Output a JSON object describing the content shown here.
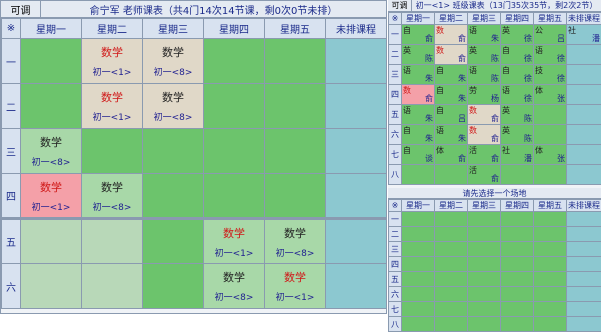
{
  "left_bar": {
    "btn": "可调",
    "title": "俞宁军 老师课表（共4门14次14节课，剩0次0节未排）"
  },
  "left_headers": [
    "※",
    "星期一",
    "星期二",
    "星期三",
    "星期四",
    "星期五",
    "未排课程"
  ],
  "left_rows": [
    {
      "label": "一",
      "cells": [
        {
          "bg": "g"
        },
        {
          "bg": "bg",
          "subj": "数学",
          "cls": "初一<1>",
          "sc": "cr"
        },
        {
          "bg": "bg",
          "subj": "数学",
          "cls": "初一<8>",
          "sc": "ck"
        },
        {
          "bg": "g"
        },
        {
          "bg": "g"
        },
        {
          "bg": "cy"
        }
      ]
    },
    {
      "label": "二",
      "cells": [
        {
          "bg": "g"
        },
        {
          "bg": "bg",
          "subj": "数学",
          "cls": "初一<1>",
          "sc": "cr"
        },
        {
          "bg": "bg",
          "subj": "数学",
          "cls": "初一<8>",
          "sc": "ck"
        },
        {
          "bg": "g"
        },
        {
          "bg": "g"
        },
        {
          "bg": "cy"
        }
      ]
    },
    {
      "label": "三",
      "cells": [
        {
          "bg": "pg",
          "subj": "数学",
          "cls": "初一<8>",
          "sc": "ck"
        },
        {
          "bg": "g"
        },
        {
          "bg": "g"
        },
        {
          "bg": "g"
        },
        {
          "bg": "g"
        },
        {
          "bg": "cy"
        }
      ]
    },
    {
      "label": "四",
      "cells": [
        {
          "bg": "pk",
          "subj": "数学",
          "cls": "初一<1>",
          "sc": "cr"
        },
        {
          "bg": "pg",
          "subj": "数学",
          "cls": "初一<8>",
          "sc": "ck"
        },
        {
          "bg": "g"
        },
        {
          "bg": "g"
        },
        {
          "bg": "g"
        },
        {
          "bg": "cy"
        }
      ]
    },
    {
      "label": "五",
      "cells": [
        {
          "bg": "lt"
        },
        {
          "bg": "lt"
        },
        {
          "bg": "g"
        },
        {
          "bg": "pg",
          "subj": "数学",
          "cls": "初一<1>",
          "sc": "cr"
        },
        {
          "bg": "pg",
          "subj": "数学",
          "cls": "初一<8>",
          "sc": "ck"
        },
        {
          "bg": "cy"
        }
      ]
    },
    {
      "label": "六",
      "cells": [
        {
          "bg": "lt"
        },
        {
          "bg": "lt"
        },
        {
          "bg": "g"
        },
        {
          "bg": "pg",
          "subj": "数学",
          "cls": "初一<8>",
          "sc": "ck"
        },
        {
          "bg": "pg",
          "subj": "数学",
          "cls": "初一<1>",
          "sc": "cr"
        },
        {
          "bg": "cy"
        }
      ]
    }
  ],
  "right_bar": {
    "btn": "可调",
    "title": "初一<1> 班级课表（13门35次35节，剩2次2节）"
  },
  "right_headers": [
    "※",
    "星期一",
    "星期二",
    "星期三",
    "星期四",
    "星期五",
    "未排课程"
  ],
  "right_rows": [
    {
      "label": "一",
      "cells": [
        {
          "s": "自",
          "t": "俞",
          "bg": "g"
        },
        {
          "s": "数",
          "t": "俞",
          "bg": "bg",
          "sc": "cr"
        },
        {
          "s": "语",
          "t": "朱",
          "bg": "g"
        },
        {
          "s": "英",
          "t": "徐",
          "bg": "g"
        },
        {
          "s": "公",
          "t": "吕",
          "bg": "g"
        },
        {
          "s": "社",
          "t": "潘",
          "bg": "cy"
        }
      ]
    },
    {
      "label": "二",
      "cells": [
        {
          "s": "英",
          "t": "陈",
          "bg": "g"
        },
        {
          "s": "数",
          "t": "俞",
          "bg": "bg",
          "sc": "cr"
        },
        {
          "s": "英",
          "t": "陈",
          "bg": "g"
        },
        {
          "s": "自",
          "t": "徐",
          "bg": "g"
        },
        {
          "s": "语",
          "t": "徐",
          "bg": "g"
        },
        {
          "s": "",
          "t": "",
          "bg": "cy"
        }
      ]
    },
    {
      "label": "三",
      "cells": [
        {
          "s": "语",
          "t": "朱",
          "bg": "g"
        },
        {
          "s": "自",
          "t": "朱",
          "bg": "g"
        },
        {
          "s": "语",
          "t": "陈",
          "bg": "g"
        },
        {
          "s": "自",
          "t": "徐",
          "bg": "g"
        },
        {
          "s": "技",
          "t": "徐",
          "bg": "g"
        },
        {
          "s": "",
          "t": "",
          "bg": "cy"
        }
      ]
    },
    {
      "label": "四",
      "cells": [
        {
          "s": "数",
          "t": "俞",
          "bg": "pk",
          "sc": "cr"
        },
        {
          "s": "自",
          "t": "朱",
          "bg": "g"
        },
        {
          "s": "劳",
          "t": "杨",
          "bg": "g"
        },
        {
          "s": "语",
          "t": "徐",
          "bg": "g"
        },
        {
          "s": "体",
          "t": "张",
          "bg": "g"
        },
        {
          "s": "",
          "t": "",
          "bg": "cy"
        }
      ]
    },
    {
      "label": "五",
      "cells": [
        {
          "s": "语",
          "t": "朱",
          "bg": "g"
        },
        {
          "s": "自",
          "t": "吕",
          "bg": "g"
        },
        {
          "s": "数",
          "t": "俞",
          "bg": "bg",
          "sc": "cr"
        },
        {
          "s": "英",
          "t": "陈",
          "bg": "g"
        },
        {
          "s": "",
          "t": "",
          "bg": "g"
        },
        {
          "s": "",
          "t": "",
          "bg": "cy"
        }
      ]
    },
    {
      "label": "六",
      "cells": [
        {
          "s": "自",
          "t": "朱",
          "bg": "g"
        },
        {
          "s": "语",
          "t": "朱",
          "bg": "g"
        },
        {
          "s": "数",
          "t": "俞",
          "bg": "bg",
          "sc": "cr"
        },
        {
          "s": "英",
          "t": "陈",
          "bg": "g"
        },
        {
          "s": "",
          "t": "",
          "bg": "g"
        },
        {
          "s": "",
          "t": "",
          "bg": "cy"
        }
      ]
    },
    {
      "label": "七",
      "cells": [
        {
          "s": "自",
          "t": "谈",
          "bg": "g"
        },
        {
          "s": "体",
          "t": "俞",
          "bg": "g"
        },
        {
          "s": "活",
          "t": "俞",
          "bg": "g"
        },
        {
          "s": "社",
          "t": "潘",
          "bg": "g"
        },
        {
          "s": "体",
          "t": "张",
          "bg": "g"
        },
        {
          "s": "",
          "t": "",
          "bg": "cy"
        }
      ]
    },
    {
      "label": "八",
      "cells": [
        {
          "s": "",
          "t": "",
          "bg": "g"
        },
        {
          "s": "",
          "t": "",
          "bg": "g"
        },
        {
          "s": "活",
          "t": "俞",
          "bg": "g"
        },
        {
          "s": "",
          "t": "",
          "bg": "g"
        },
        {
          "s": "",
          "t": "",
          "bg": "g"
        },
        {
          "s": "",
          "t": "",
          "bg": "cy"
        }
      ]
    }
  ],
  "venue_title": "请先选择一个场地",
  "venue_headers": [
    "※",
    "星期一",
    "星期二",
    "星期三",
    "星期四",
    "星期五",
    "未排课程"
  ],
  "venue_rows": [
    "一",
    "二",
    "三",
    "四",
    "五",
    "六",
    "七",
    "八"
  ]
}
